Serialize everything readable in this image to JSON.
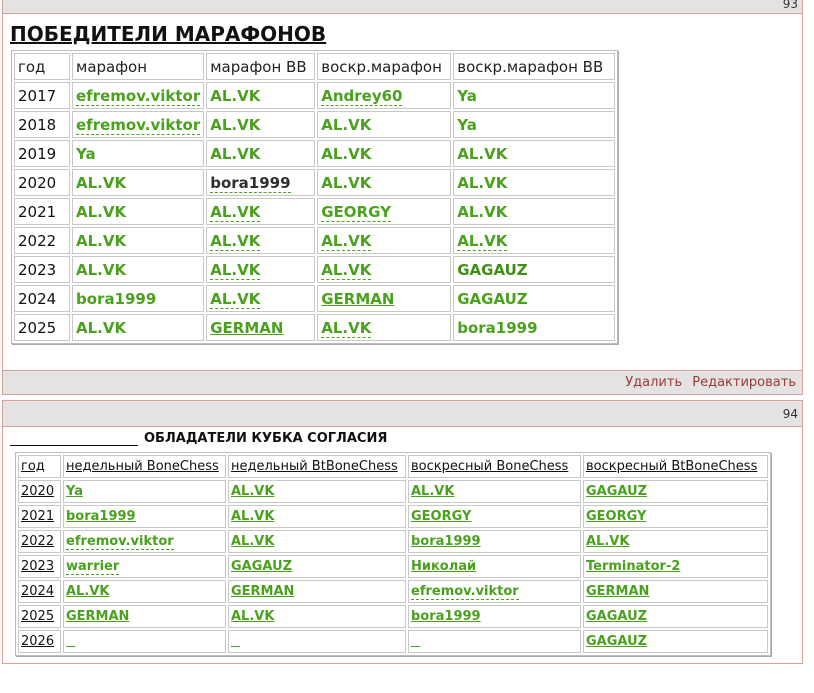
{
  "post1": {
    "number": "93",
    "title": "ПОБЕДИТЕЛИ МАРАФОНОВ",
    "headers": [
      "год",
      "марафон",
      "марафон ВВ",
      "воскр.марафон",
      "воскр.марафон ВВ"
    ],
    "rows": [
      [
        "2017",
        "efremov.viktor",
        "AL.VK",
        "Andrey60",
        "Ya"
      ],
      [
        "2018",
        "efremov.viktor",
        "AL.VK",
        "AL.VK",
        "Ya"
      ],
      [
        "2019",
        "Ya",
        "AL.VK",
        "AL.VK",
        "AL.VK"
      ],
      [
        "2020",
        "AL.VK",
        "bora1999",
        "AL.VK",
        "AL.VK"
      ],
      [
        "2021",
        "AL.VK",
        "AL.VK",
        "GEORGY",
        "AL.VK"
      ],
      [
        "2022",
        "AL.VK",
        "AL.VK",
        "AL.VK",
        "AL.VK"
      ],
      [
        "2023",
        "AL.VK",
        "AL.VK",
        "AL.VK",
        "GAGAUZ"
      ],
      [
        "2024",
        "bora1999",
        "AL.VK",
        "GERMAN",
        "GAGAUZ"
      ],
      [
        "2025",
        "AL.VK",
        "GERMAN",
        "AL.VK",
        "bora1999"
      ]
    ],
    "actions": {
      "delete": "Удалить",
      "edit": "Редактировать"
    }
  },
  "post2": {
    "number": "94",
    "title": "ОБЛАДАТЕЛИ КУБКА СОГЛАСИЯ",
    "headers": [
      "год",
      "недельный BoneChess",
      "недельный BtBoneChess",
      "воскресный BoneChess",
      "воскресный BtBoneChess"
    ],
    "rows": [
      [
        "2020",
        "Ya",
        "AL.VK",
        "AL.VK",
        "GAGAUZ"
      ],
      [
        "2021",
        "bora1999",
        "AL.VK",
        "GEORGY",
        "GEORGY"
      ],
      [
        "2022",
        "efremov.viktor",
        "AL.VK",
        "bora1999",
        "AL.VK"
      ],
      [
        "2023",
        "warrier",
        "GAGAUZ",
        "Николай",
        "Terminator-2"
      ],
      [
        "2024",
        "AL.VK",
        "GERMAN",
        "efremov.viktor",
        "GERMAN"
      ],
      [
        "2025",
        "GERMAN",
        "AL.VK",
        "bora1999",
        "GAGAUZ"
      ],
      [
        "2026",
        "",
        "",
        "",
        "GAGAUZ"
      ]
    ]
  },
  "colors": {
    "accent_green": "#4aa11d",
    "border_red": "#d9a0a0",
    "bar_gray": "#e3e3e3",
    "action_red": "#9b3a3a"
  }
}
